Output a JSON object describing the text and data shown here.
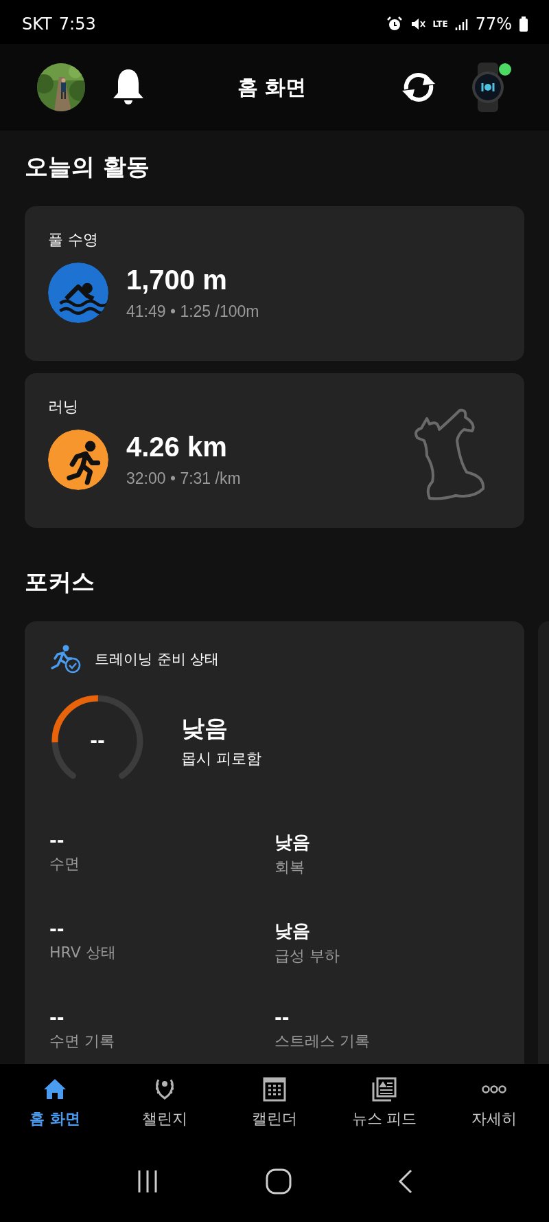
{
  "status_bar": {
    "carrier": "SKT",
    "time": "7:53",
    "network": "LTE",
    "battery": "77%"
  },
  "header": {
    "title": "홈 화면"
  },
  "today": {
    "title": "오늘의 활동",
    "activities": [
      {
        "kind": "swim",
        "name": "풀 수영",
        "value": "1,700 m",
        "detail": "41:49 • 1:25 /100m",
        "color": "#1e73d2",
        "has_route": false
      },
      {
        "kind": "run",
        "name": "러닝",
        "value": "4.26 km",
        "detail": "32:00 • 7:31 /km",
        "color": "#f7962d",
        "has_route": true
      }
    ]
  },
  "focus": {
    "title": "포커스",
    "card": {
      "title": "트레이닝 준비 상태",
      "score": "--",
      "status": "낮음",
      "status_detail": "몹시 피로함",
      "metrics": [
        {
          "value": "--",
          "label": "수면"
        },
        {
          "value": "낮음",
          "label": "회복"
        },
        {
          "value": "--",
          "label": "HRV 상태"
        },
        {
          "value": "낮음",
          "label": "급성 부하"
        },
        {
          "value": "--",
          "label": "수면 기록"
        },
        {
          "value": "--",
          "label": "스트레스 기록"
        }
      ]
    }
  },
  "nav": {
    "items": [
      {
        "kind": "home",
        "label": "홈 화면",
        "selected": true
      },
      {
        "kind": "challenges",
        "label": "챌린지",
        "selected": false
      },
      {
        "kind": "calendar",
        "label": "캘린더",
        "selected": false
      },
      {
        "kind": "news",
        "label": "뉴스 피드",
        "selected": false
      },
      {
        "kind": "more",
        "label": "자세히",
        "selected": false
      }
    ]
  }
}
